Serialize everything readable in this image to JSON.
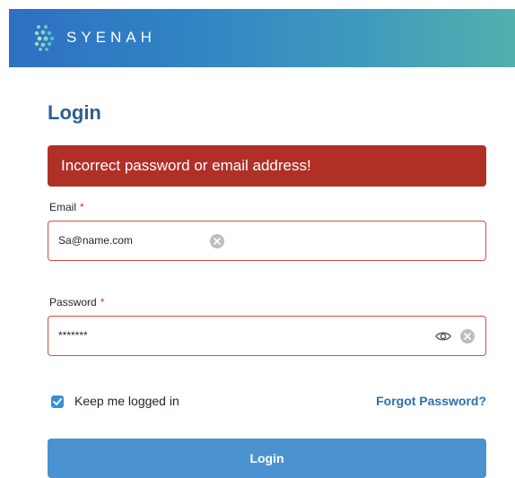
{
  "header": {
    "brand": "SYENAH",
    "logo_icon": "dots-grid-logo-icon",
    "gradient_colors": [
      "#2e6fc2",
      "#52b0ad"
    ]
  },
  "page": {
    "title": "Login"
  },
  "alert": {
    "message": "Incorrect password or email address!",
    "color": "#b03027"
  },
  "form": {
    "email": {
      "label": "Email",
      "required_mark": "*",
      "value": "Sa@name.com",
      "clear_icon": "clear-circle-icon"
    },
    "password": {
      "label": "Password",
      "required_mark": "*",
      "value": "*******",
      "reveal_icon": "eye-icon",
      "clear_icon": "clear-circle-icon"
    },
    "remember": {
      "label": "Keep me logged in",
      "checked": true
    },
    "forgot_label": "Forgot Password?",
    "submit_label": "Login",
    "error_border_color": "#d84a3c",
    "accent_color": "#4a92d0"
  }
}
